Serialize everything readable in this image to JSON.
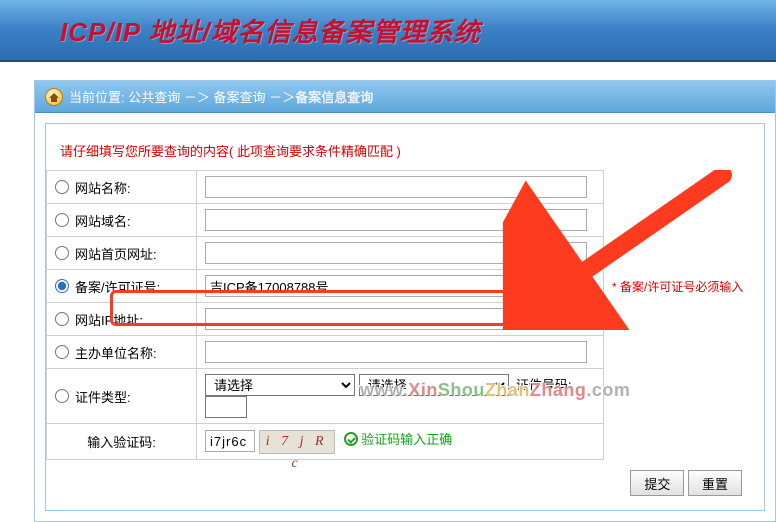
{
  "header": {
    "title": "ICP/IP 地址/域名信息备案管理系统"
  },
  "breadcrumb": {
    "label": "当前位置:",
    "l1": "公共查询",
    "sep": "－＞",
    "l2": "备案查询",
    "l3": "备案信息查询"
  },
  "instruction": "请仔细填写您所要查询的内容( 此项查询要求条件精确匹配 )",
  "rows": {
    "site_name": {
      "label": "网站名称:"
    },
    "site_domain": {
      "label": "网站域名:"
    },
    "site_url": {
      "label": "网站首页网址:"
    },
    "icp_no": {
      "label": "备案/许可证号:",
      "value": "吉ICP备17008788号",
      "note": "* 备案/许可证号必须输入"
    },
    "site_ip": {
      "label": "网站IP地址:"
    },
    "org": {
      "label": "主办单位名称:"
    },
    "cert": {
      "label": "证件类型:",
      "sel1": "请选择",
      "sel2": "请选择",
      "idno_label": "证件号码:"
    },
    "captcha": {
      "label": "输入验证码:",
      "value": "i7jr6c",
      "image_text": "i 7 j R c",
      "ok_text": "验证码输入正确"
    }
  },
  "buttons": {
    "submit": "提交",
    "reset": "重置"
  },
  "watermark": {
    "p1": "www.",
    "p2": "Xin",
    "p3": "Shou",
    "p4": "Zhan",
    "p5": "Zhang",
    "p6": ".com"
  }
}
